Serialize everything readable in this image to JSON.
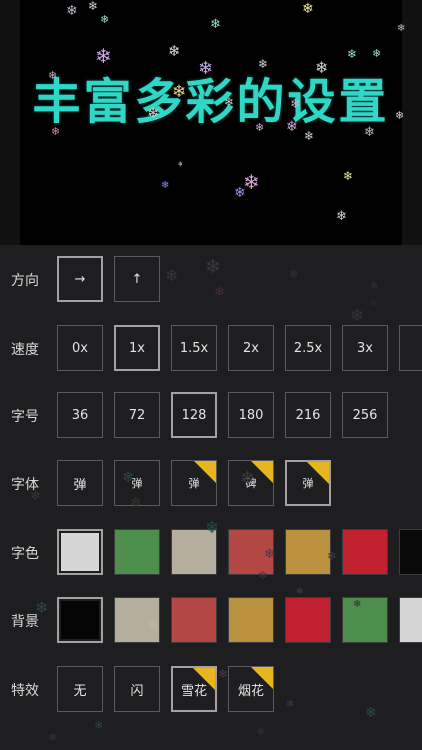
{
  "headline": "丰富多彩的设置",
  "snowflake_glyph": "❄",
  "accent": {
    "headline": "#2fd7c6",
    "new_badge": "#e6b51f",
    "selected_border": "#a79fa1"
  },
  "rows": {
    "direction": {
      "label": "方向",
      "options": [
        {
          "text": "→",
          "selected": true,
          "icon": "arrow-right-icon"
        },
        {
          "text": "↑",
          "selected": false,
          "icon": "arrow-up-icon"
        }
      ]
    },
    "speed": {
      "label": "速度",
      "options": [
        {
          "text": "0x",
          "selected": false
        },
        {
          "text": "1x",
          "selected": true
        },
        {
          "text": "1.5x",
          "selected": false
        },
        {
          "text": "2x",
          "selected": false
        },
        {
          "text": "2.5x",
          "selected": false
        },
        {
          "text": "3x",
          "selected": false
        }
      ]
    },
    "size": {
      "label": "字号",
      "options": [
        {
          "text": "36",
          "selected": false
        },
        {
          "text": "72",
          "selected": false
        },
        {
          "text": "128",
          "selected": true
        },
        {
          "text": "180",
          "selected": false
        },
        {
          "text": "216",
          "selected": false
        },
        {
          "text": "256",
          "selected": false
        }
      ]
    },
    "font": {
      "label": "字体",
      "options": [
        {
          "text": "弹",
          "selected": false,
          "badge": false
        },
        {
          "text": "弹",
          "selected": false,
          "badge": false
        },
        {
          "text": "弹",
          "selected": false,
          "badge": true
        },
        {
          "text": "碑",
          "selected": false,
          "badge": true
        },
        {
          "text": "弹",
          "selected": true,
          "badge": true
        }
      ]
    },
    "text_color": {
      "label": "字色",
      "swatches": [
        "#d6d6d6",
        "#4d8e4d",
        "#b5ae9e",
        "#b24744",
        "#ba913e",
        "#c1212f"
      ],
      "selected_index": 0
    },
    "background": {
      "label": "背景",
      "swatches": [
        "#050505",
        "#b5ae9e",
        "#b24744",
        "#ba913e",
        "#c1212f",
        "#4d8e4d"
      ],
      "selected_index": 0
    },
    "effect": {
      "label": "特效",
      "options": [
        {
          "text": "无",
          "selected": false,
          "badge": false
        },
        {
          "text": "闪",
          "selected": false,
          "badge": false
        },
        {
          "text": "雪花",
          "selected": true,
          "badge": true
        },
        {
          "text": "烟花",
          "selected": false,
          "badge": true
        }
      ]
    }
  }
}
